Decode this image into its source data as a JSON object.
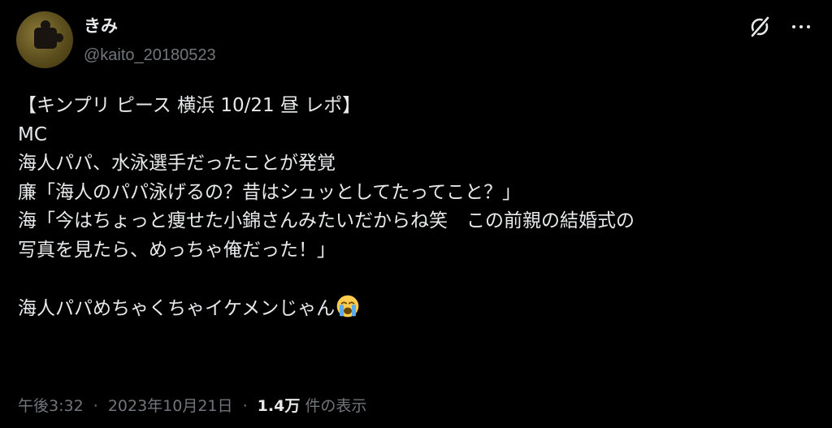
{
  "author": {
    "display_name": "きみ",
    "handle": "@kaito_20180523"
  },
  "icons": {
    "grok": "grok-slash-circle-icon",
    "more": "more-horizontal-icon",
    "emoji": "loudly-crying-face-emoji"
  },
  "tweet": {
    "lines": [
      "【キンプリ ピース 横浜 10/21 昼 レポ】",
      "MC",
      "海人パパ、水泳選手だったことが発覚",
      "廉「海人のパパ泳げるの？昔はシュッとしてたってこと？」",
      "海「今はちょっと痩せた小錦さんみたいだからね笑　この前親の結婚式の",
      "写真を見たら、めっちゃ俺だった！」",
      "",
      "海人パパめちゃくちゃイケメンじゃん"
    ]
  },
  "meta": {
    "time": "午後3:32",
    "separator": "·",
    "date": "2023年10月21日",
    "views_count": "1.4万",
    "views_label": "件の表示"
  },
  "colors": {
    "background": "#000000",
    "text_primary": "#e7e9ea",
    "text_secondary": "#71767b"
  }
}
